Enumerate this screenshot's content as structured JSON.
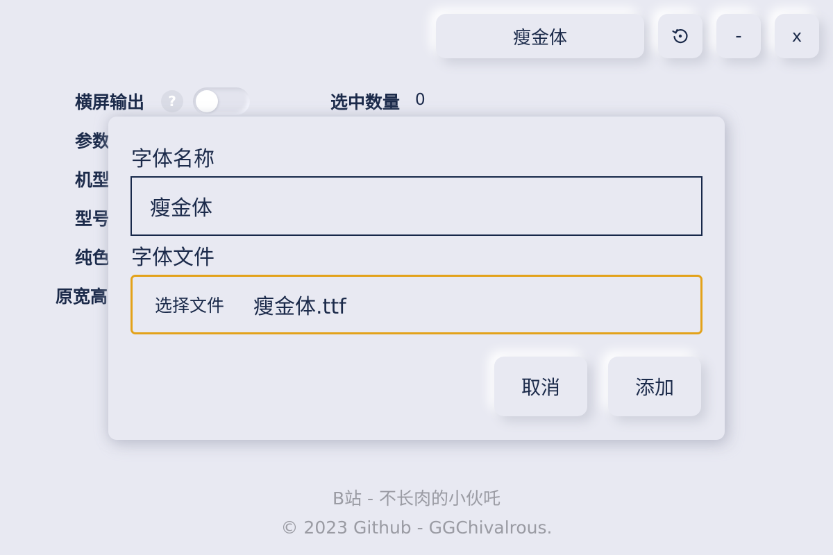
{
  "toolbar": {
    "font_select_value": "瘦金体",
    "minimize_label": "-",
    "close_label": "x"
  },
  "settings": {
    "landscape_label": "横屏输出",
    "help_symbol": "?",
    "landscape_enabled": false,
    "params_label": "参数",
    "model_label": "机型",
    "type_label": "型号",
    "solid_label": "纯色",
    "size_label": "原宽高",
    "selected_count_label": "选中数量",
    "selected_count_value": "0"
  },
  "dialog": {
    "name_label": "字体名称",
    "name_value": "瘦金体",
    "file_label": "字体文件",
    "file_button_label": "选择文件",
    "file_name": "瘦金体.ttf",
    "cancel_label": "取消",
    "add_label": "添加",
    "file_field_border_color": "#e3a21a"
  },
  "footer": {
    "line1": "B站 - 不长肉的小伙吒",
    "line2": "© 2023 Github - GGChivalrous."
  }
}
